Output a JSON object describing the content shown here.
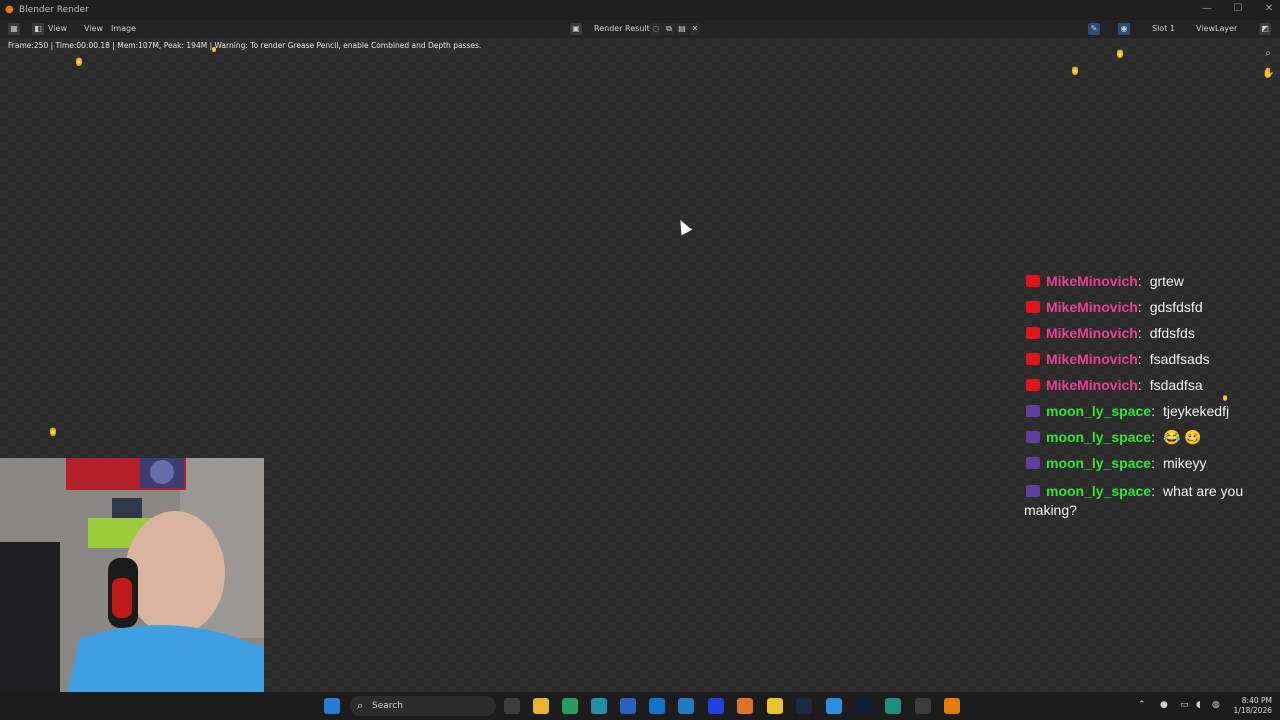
{
  "window": {
    "title": "Blender Render"
  },
  "header": {
    "menus": [
      "View",
      "View",
      "Image"
    ],
    "image_name": "Render Result",
    "slot": "Slot 1",
    "view_layer": "ViewLayer"
  },
  "status_text": "Frame:250 | Time:00:00.18 | Mem:107M, Peak: 194M | Warning: To render Grease Pencil, enable Combined and Depth passes.",
  "chat": {
    "messages": [
      {
        "user": "MikeMinovich",
        "text": "grtew",
        "color": "#e9418f",
        "badge": "red"
      },
      {
        "user": "MikeMinovich",
        "text": "gdsfdsfd",
        "color": "#e9418f",
        "badge": "red"
      },
      {
        "user": "MikeMinovich",
        "text": "dfdsfds",
        "color": "#e9418f",
        "badge": "red"
      },
      {
        "user": "MikeMinovich",
        "text": "fsadfsads",
        "color": "#e9418f",
        "badge": "red"
      },
      {
        "user": "MikeMinovich",
        "text": "fsdadfsa",
        "color": "#e9418f",
        "badge": "red"
      },
      {
        "user": "moon_ly_space",
        "text": "tjeykekedfj",
        "color": "#35e235",
        "badge": "purple"
      },
      {
        "user": "moon_ly_space",
        "text": "😂 🥴",
        "color": "#35e235",
        "badge": "purple"
      },
      {
        "user": "moon_ly_space",
        "text": "mikeyy",
        "color": "#35e235",
        "badge": "purple"
      },
      {
        "user": "moon_ly_space",
        "text": "what are you making?",
        "color": "#35e235",
        "badge": "purple"
      }
    ]
  },
  "taskbar": {
    "search_placeholder": "Search",
    "time": "8:40 PM",
    "date": "1/18/2026"
  },
  "colors": {
    "accent": "#e87d0d",
    "mike": "#e9418f",
    "moon": "#35e235"
  }
}
